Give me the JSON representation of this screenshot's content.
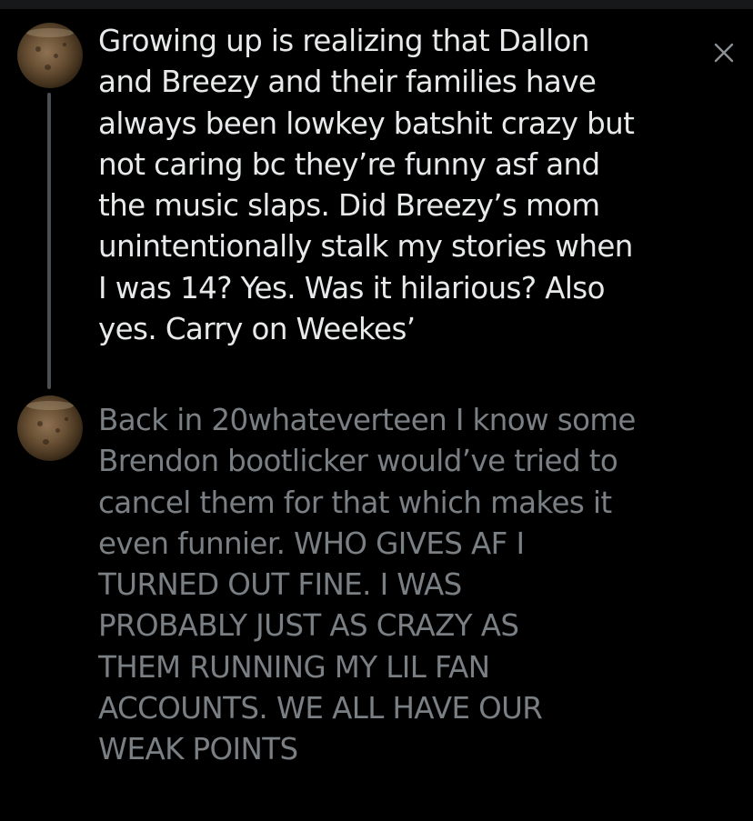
{
  "thread": {
    "tweets": [
      {
        "avatar_icon": "user-avatar",
        "text": "Growing up is realizing that Dallon\nand Breezy and their families have\nalways been lowkey batshit crazy but\nnot caring bc they’re funny asf and\nthe music slaps. Did Breezy’s mom\nunintentionally stalk my stories when\nI was 14? Yes. Was it hilarious? Also\nyes. Carry on Weekes’",
        "text_color": "#e7e9ea"
      },
      {
        "avatar_icon": "user-avatar",
        "text": "Back in 20whateverteen I know some\nBrendon bootlicker would’ve tried to\ncancel them for that which makes it\neven funnier. WHO GIVES AF I\nTURNED OUT FINE. I WAS\nPROBABLY JUST AS CRAZY AS\nTHEM RUNNING MY LIL FAN\nACCOUNTS. WE ALL HAVE OUR\nWEAK POINTS",
        "text_color": "#7a7f84"
      }
    ],
    "close_icon": "close-icon",
    "connector_color": "#4a4f54"
  },
  "theme": {
    "background": "#000000",
    "top_bar": "#16181a"
  }
}
